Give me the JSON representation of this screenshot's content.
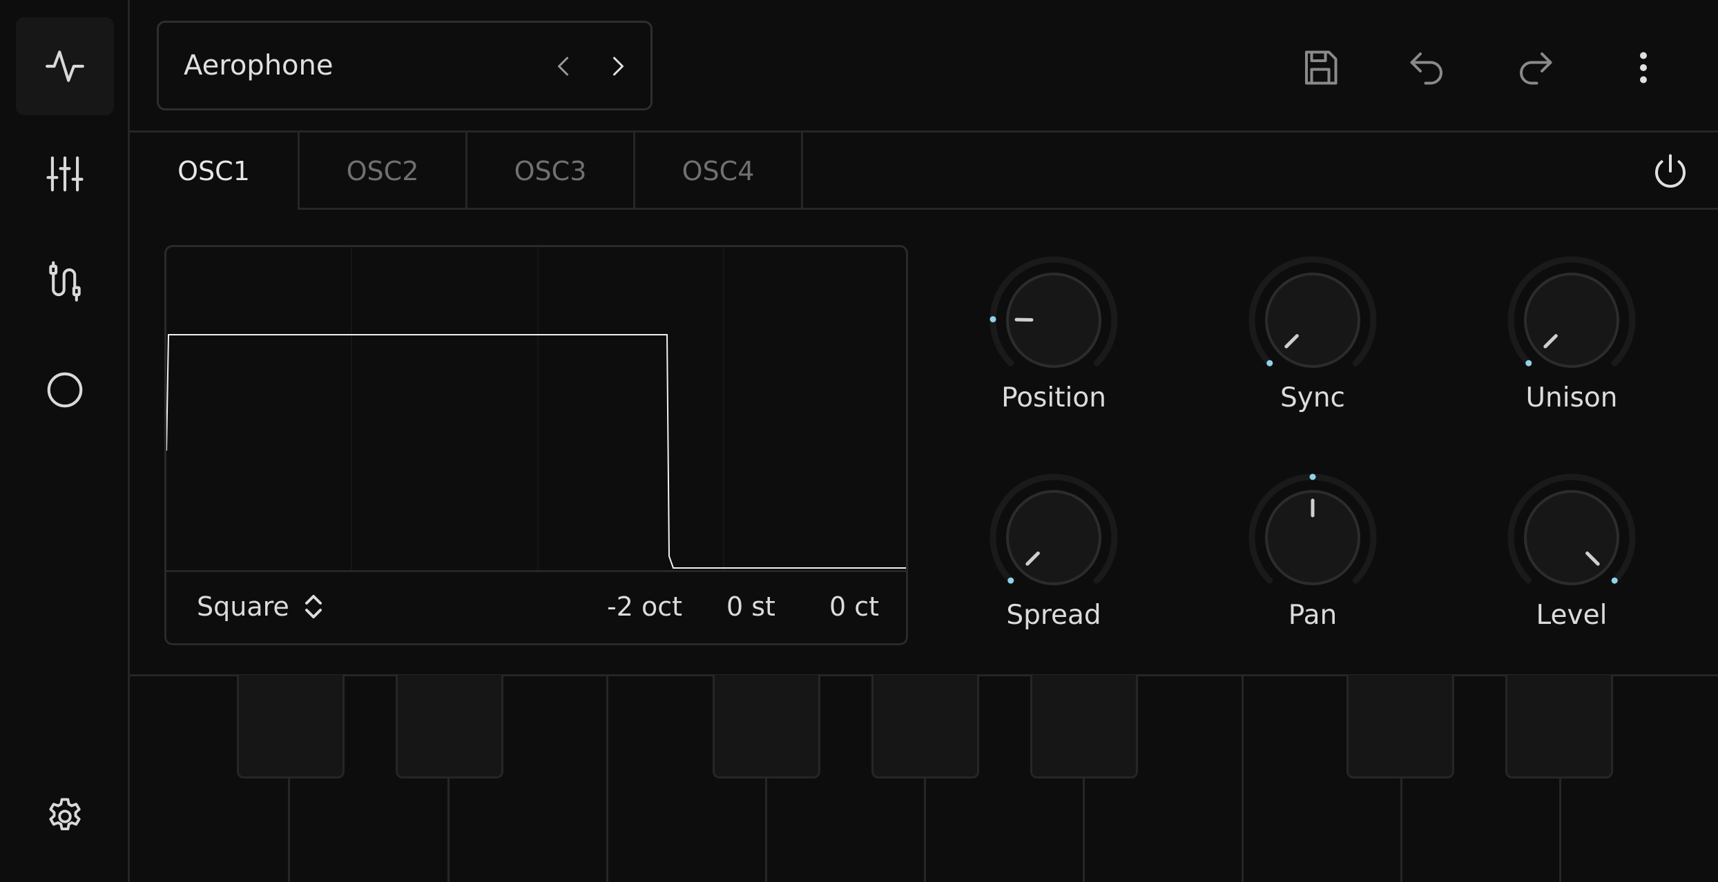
{
  "sidebar": {
    "items": [
      {
        "name": "oscillator",
        "icon": "waveform-icon",
        "active": true
      },
      {
        "name": "mixer",
        "icon": "sliders-icon",
        "active": false
      },
      {
        "name": "routing",
        "icon": "patch-cable-icon",
        "active": false
      },
      {
        "name": "effects",
        "icon": "circle-icon",
        "active": false
      }
    ],
    "settings_icon": "gear-icon"
  },
  "header": {
    "preset_name": "Aerophone",
    "prev_icon": "chevron-left-icon",
    "next_icon": "chevron-right-icon",
    "actions": [
      "save-icon",
      "undo-icon",
      "redo-icon",
      "more-vertical-icon"
    ]
  },
  "tabs": [
    {
      "label": "OSC1",
      "active": true
    },
    {
      "label": "OSC2",
      "active": false
    },
    {
      "label": "OSC3",
      "active": false
    },
    {
      "label": "OSC4",
      "active": false
    }
  ],
  "power_icon": "power-icon",
  "waveform": {
    "type": "Square",
    "octave": "-2 oct",
    "semitone": "0 st",
    "cents": "0 ct"
  },
  "knobs": [
    {
      "label": "Position",
      "value": 0.17
    },
    {
      "label": "Sync",
      "value": 0.0
    },
    {
      "label": "Unison",
      "value": 0.0
    },
    {
      "label": "Spread",
      "value": 0.0
    },
    {
      "label": "Pan",
      "value": 0.5
    },
    {
      "label": "Level",
      "value": 1.0
    }
  ],
  "colors": {
    "background": "#0d0d0d",
    "accent": "#8fd3e8",
    "border": "#262626",
    "text": "#dcdcdc",
    "muted_text": "#707070"
  }
}
